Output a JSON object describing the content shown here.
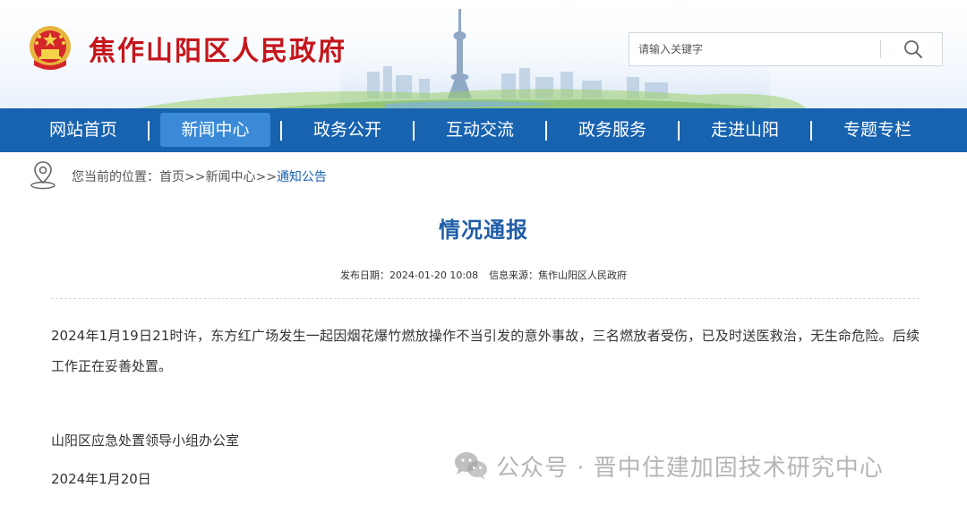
{
  "header": {
    "site_title": "焦作山阳区人民政府",
    "search_placeholder": "请输入关键字",
    "emblem_icon": "national-emblem-icon",
    "search_icon": "search-icon",
    "title_color": "#c4161c"
  },
  "nav": {
    "bg_color": "#1863b0",
    "items": [
      {
        "label": "网站首页",
        "active": false
      },
      {
        "label": "新闻中心",
        "active": true
      },
      {
        "label": "政务公开",
        "active": false
      },
      {
        "label": "互动交流",
        "active": false
      },
      {
        "label": "政务服务",
        "active": false
      },
      {
        "label": "走进山阳",
        "active": false
      },
      {
        "label": "专题专栏",
        "active": false
      }
    ],
    "separator": "|"
  },
  "breadcrumb": {
    "prefix": "您当前的位置：",
    "home": "首页",
    "sep": ">>",
    "section": "新闻中心",
    "current": "通知公告",
    "icon": "location-pin-icon"
  },
  "article": {
    "title": "情况通报",
    "date_label": "发布日期：",
    "date": "2024-01-20 10:08",
    "source_label": "信息来源：",
    "source": "焦作山阳区人民政府",
    "body": "2024年1月19日21时许，东方红广场发生一起因烟花爆竹燃放操作不当引发的意外事故，三名燃放者受伤，已及时送医救治，无生命危险。后续工作正在妥善处置。",
    "signoff": "山阳区应急处置领导小组办公室",
    "signdate": "2024年1月20日"
  },
  "watermark": {
    "text": "公众号 · 晋中住建加固技术研究中心",
    "icon": "wechat-icon"
  }
}
